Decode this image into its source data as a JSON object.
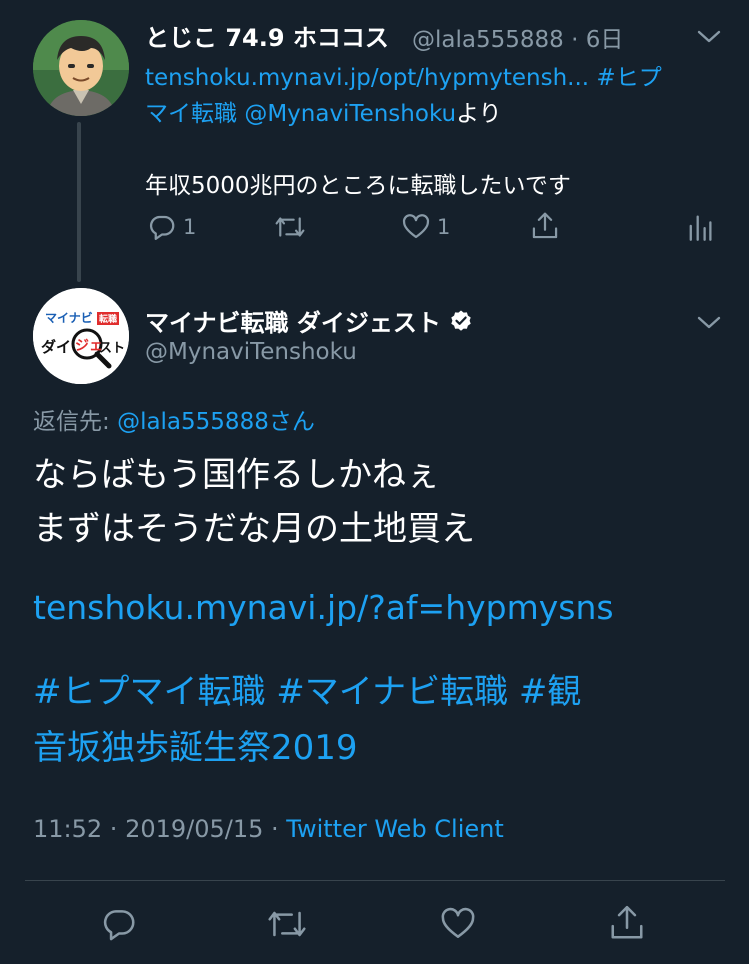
{
  "parent_tweet": {
    "display_name": "とじこ 74.9 ホココス",
    "handle": "@lala555888",
    "separator": "·",
    "time_ago": "6日",
    "link_text": "tenshoku.mynavi.jp/opt/hypmytensh...",
    "hashtag_part1": "#ヒプ",
    "hashtag_part2": "マイ転職",
    "mention": "@MynaviTenshoku",
    "mention_suffix": "より",
    "body": "年収5000兆円のところに転職したいです",
    "reply_count": "1",
    "like_count": "1"
  },
  "main_tweet": {
    "display_name": "マイナビ転職 ダイジェスト",
    "handle": "@MynaviTenshoku",
    "reply_label": "返信先: ",
    "reply_handle": "@lala555888",
    "reply_suffix": "さん",
    "body_line1": "ならばもう国作るしかねぇ",
    "body_line2": "まずはそうだな月の土地買え",
    "url": "tenshoku.mynavi.jp/?af=hypmysns",
    "hashtags_line1": "#ヒプマイ転職 #マイナビ転職 #観",
    "hashtags_line2": "音坂独歩誕生祭2019",
    "time": "11:52",
    "date": "2019/05/15",
    "meta_separator": " · ",
    "meta_separator2": " · ",
    "client": "Twitter Web Client",
    "avatar_logo_top": "マイナビ",
    "avatar_logo_tag": "転職",
    "avatar_logo_bottom1": "ダイ",
    "avatar_logo_bottom2": "ジェ",
    "avatar_logo_bottom3": "スト"
  },
  "icons": {
    "verified": "verified-badge-icon",
    "reply": "reply-icon",
    "retweet": "retweet-icon",
    "like": "heart-icon",
    "share": "share-icon",
    "analytics": "analytics-icon",
    "more": "chevron-down-icon"
  },
  "colors": {
    "background": "#15202b",
    "text": "#ffffff",
    "muted": "#8899a6",
    "link": "#1da1f2",
    "divider": "#38444d"
  }
}
